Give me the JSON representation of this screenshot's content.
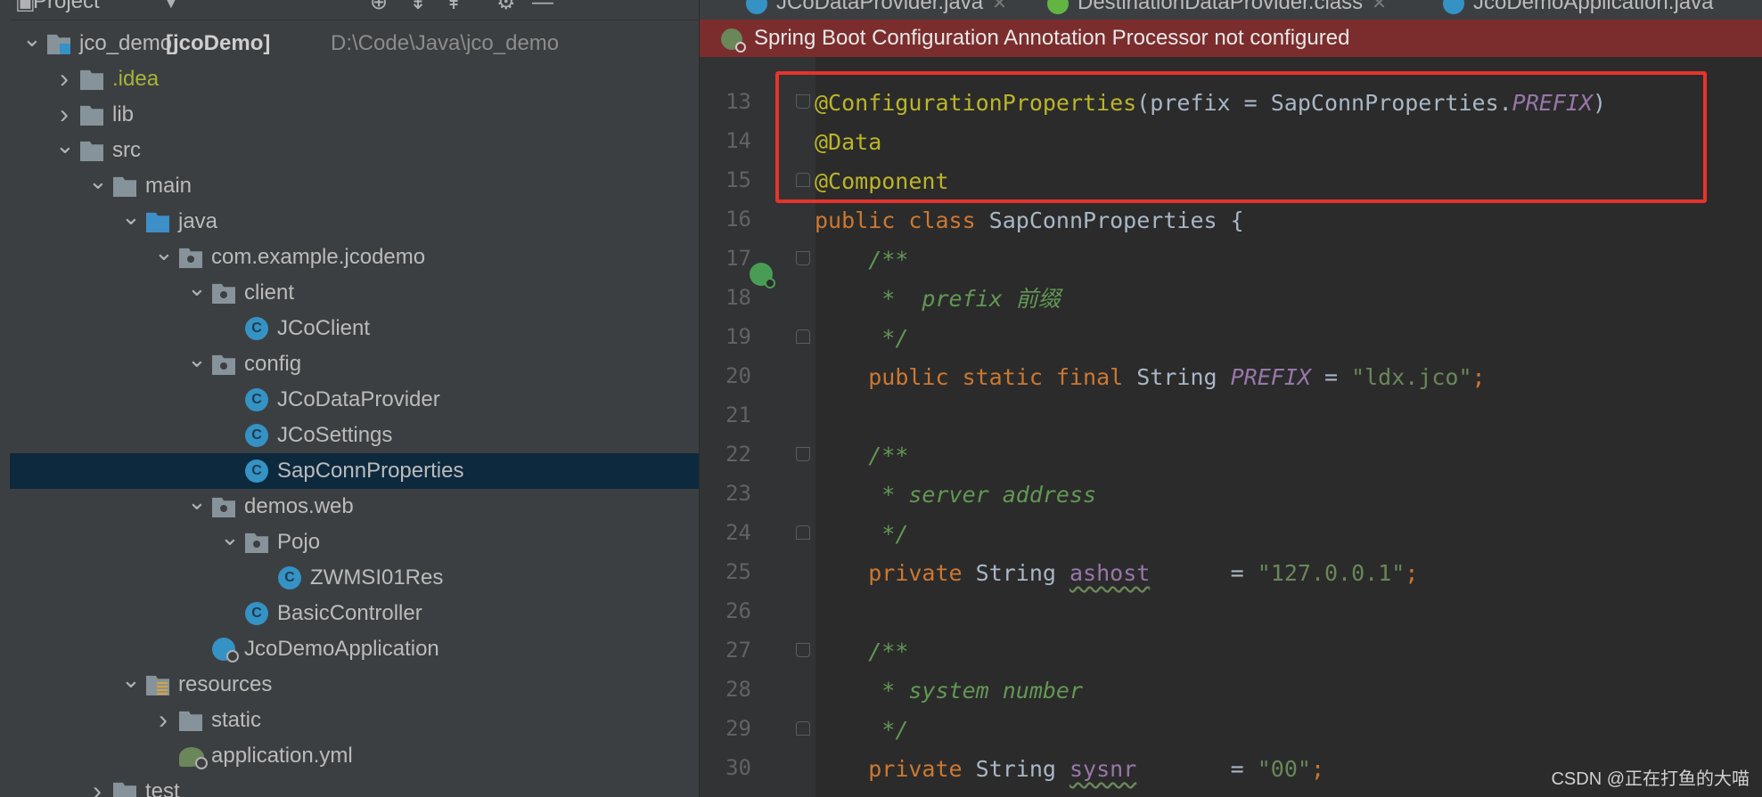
{
  "project_panel": {
    "title": "Project",
    "tree": [
      {
        "name": "root",
        "label": "jco_demo",
        "module": "[jcoDemo]",
        "path": "D:\\Code\\Java\\jco_demo",
        "indent": 0,
        "expanded": true,
        "icon": "project-folder-icon"
      },
      {
        "name": "idea",
        "label": ".idea",
        "indent": 1,
        "expanded": false,
        "icon": "folder-icon"
      },
      {
        "name": "lib",
        "label": "lib",
        "indent": 1,
        "expanded": false,
        "icon": "folder-icon"
      },
      {
        "name": "src",
        "label": "src",
        "indent": 1,
        "expanded": true,
        "icon": "folder-icon"
      },
      {
        "name": "main",
        "label": "main",
        "indent": 2,
        "expanded": true,
        "icon": "folder-icon"
      },
      {
        "name": "java",
        "label": "java",
        "indent": 3,
        "expanded": true,
        "icon": "source-folder-icon"
      },
      {
        "name": "package",
        "label": "com.example.jcodemo",
        "indent": 4,
        "expanded": true,
        "icon": "package-icon"
      },
      {
        "name": "client",
        "label": "client",
        "indent": 5,
        "expanded": true,
        "icon": "package-icon"
      },
      {
        "name": "jcoclient",
        "label": "JCoClient",
        "indent": 6,
        "icon": "class-icon"
      },
      {
        "name": "config",
        "label": "config",
        "indent": 5,
        "expanded": true,
        "icon": "package-icon"
      },
      {
        "name": "jcodataprovider",
        "label": "JCoDataProvider",
        "indent": 6,
        "icon": "class-icon"
      },
      {
        "name": "jcosettings",
        "label": "JCoSettings",
        "indent": 6,
        "icon": "class-icon"
      },
      {
        "name": "sapconnproperties",
        "label": "SapConnProperties",
        "indent": 6,
        "icon": "class-icon",
        "selected": true
      },
      {
        "name": "demos-web",
        "label": "demos.web",
        "indent": 5,
        "expanded": true,
        "icon": "package-icon"
      },
      {
        "name": "pojo",
        "label": "Pojo",
        "indent": 6,
        "expanded": true,
        "icon": "package-icon"
      },
      {
        "name": "zwmsi01res",
        "label": "ZWMSI01Res",
        "indent": 7,
        "icon": "class-icon"
      },
      {
        "name": "basiccontroller",
        "label": "BasicController",
        "indent": 6,
        "icon": "class-icon"
      },
      {
        "name": "jcodemoapplication",
        "label": "JcoDemoApplication",
        "indent": 5,
        "icon": "spring-boot-class-icon"
      },
      {
        "name": "resources",
        "label": "resources",
        "indent": 3,
        "expanded": true,
        "icon": "resources-folder-icon"
      },
      {
        "name": "static",
        "label": "static",
        "indent": 4,
        "expanded": false,
        "icon": "folder-icon"
      },
      {
        "name": "application-yml",
        "label": "application.yml",
        "indent": 4,
        "icon": "yaml-config-icon"
      },
      {
        "name": "test",
        "label": "test",
        "indent": 2,
        "expanded": false,
        "icon": "folder-icon"
      }
    ]
  },
  "editor": {
    "tabs": [
      {
        "label": "JCoDataProvider.java",
        "icon": "class-icon",
        "color": "#3592c4"
      },
      {
        "label": "DestinationDataProvider.class",
        "icon": "interface-icon",
        "color": "#62b543"
      },
      {
        "label": "JcoDemoApplication.java",
        "icon": "spring-boot-class-icon",
        "color": "#3592c4"
      }
    ],
    "banner": "Spring Boot Configuration Annotation Processor not configured",
    "line_numbers": [
      "13",
      "14",
      "15",
      "16",
      "17",
      "18",
      "19",
      "20",
      "21",
      "22",
      "23",
      "24",
      "25",
      "26",
      "27",
      "28",
      "29",
      "30"
    ],
    "code": {
      "l13_ann": "@ConfigurationProperties",
      "l13_args": "(prefix = SapConnProperties.",
      "l13_const": "PREFIX",
      "l13_end": ")",
      "l14": "@Data",
      "l15": "@Component",
      "l16_kw": "public class ",
      "l16_rest": "SapConnProperties {",
      "l17": "/**",
      "l18": " *  prefix 前缀",
      "l19": " */",
      "l20_kw": "public static final ",
      "l20_type": "String ",
      "l20_const": "PREFIX",
      "l20_eq": " = ",
      "l20_str": "\"ldx.jco\"",
      "l20_end": ";",
      "l22": "/**",
      "l23": " * server address",
      "l24": " */",
      "l25_kw": "private ",
      "l25_type": "String ",
      "l25_field": "ashost",
      "l25_eq": "      = ",
      "l25_str": "\"127.0.0.1\"",
      "l25_end": ";",
      "l27": "/**",
      "l28": " * system number",
      "l29": " */",
      "l30_kw": "private ",
      "l30_type": "String ",
      "l30_field": "sysnr",
      "l30_eq": "       = ",
      "l30_str": "\"00\"",
      "l30_end": ";"
    }
  },
  "watermark": "CSDN @正在打鱼的大喵",
  "colors": {
    "highlight_box": "#e8332b",
    "banner_bg": "#7b2d2d",
    "selection": "#0d293e"
  }
}
